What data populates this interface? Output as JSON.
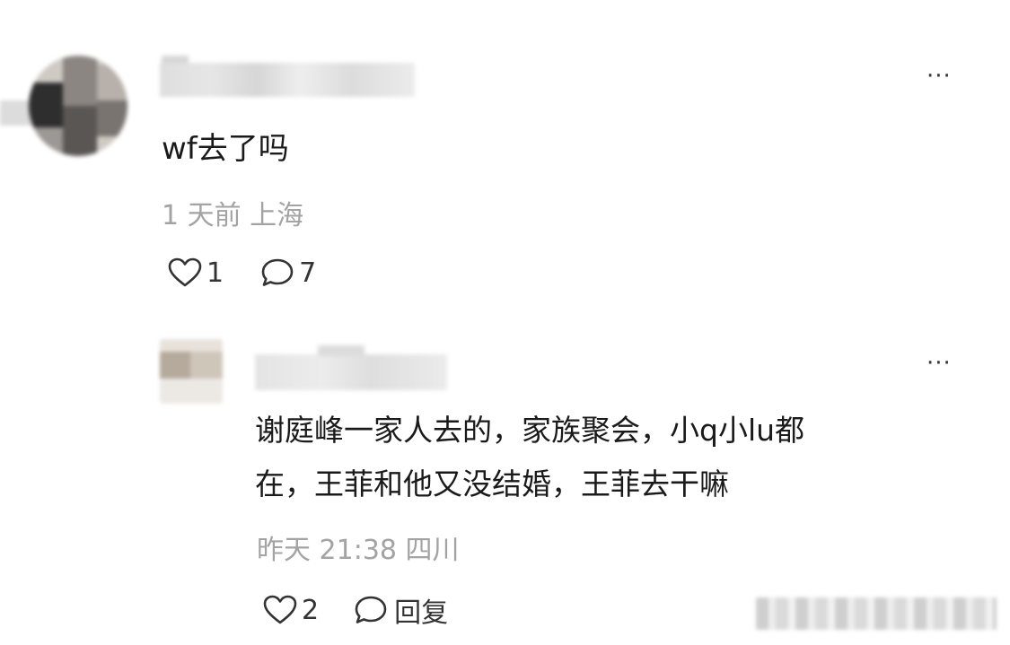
{
  "main_comment": {
    "text": "wf去了吗",
    "meta": "1 天前 上海",
    "like_count": "1",
    "reply_count": "7",
    "more_label": "···"
  },
  "reply": {
    "lines": [
      "谢庭峰一家人去的，家族聚会，小q小lu都",
      "在，王菲和他又没结婚，王菲去干嘛"
    ],
    "meta": "昨天 21:38 四川",
    "like_count": "2",
    "reply_label": "回复",
    "more_label": "···"
  },
  "icons": {
    "like": "heart-outline-icon",
    "comment": "speech-bubble-outline-icon",
    "more": "more-dots-icon"
  },
  "colors": {
    "text_primary": "#1a1a1a",
    "text_meta": "#a3a3a3",
    "icon": "#333333",
    "background": "#ffffff"
  }
}
